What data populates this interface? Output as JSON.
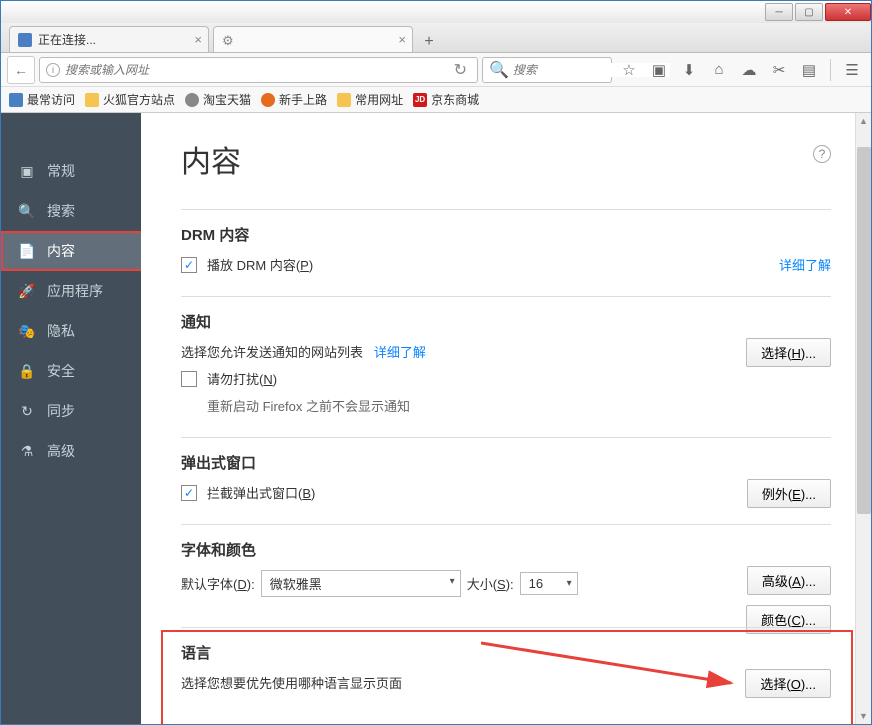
{
  "window": {
    "tabs": [
      {
        "title": "正在连接..."
      },
      {
        "title": ""
      }
    ]
  },
  "nav": {
    "url_placeholder": "搜索或输入网址",
    "search_placeholder": "搜索"
  },
  "bookmarks": [
    {
      "label": "最常访问"
    },
    {
      "label": "火狐官方站点"
    },
    {
      "label": "淘宝天猫"
    },
    {
      "label": "新手上路"
    },
    {
      "label": "常用网址"
    },
    {
      "label": "京东商城",
      "jd": "JD"
    }
  ],
  "sidebar": [
    {
      "label": "常规"
    },
    {
      "label": "搜索"
    },
    {
      "label": "内容"
    },
    {
      "label": "应用程序"
    },
    {
      "label": "隐私"
    },
    {
      "label": "安全"
    },
    {
      "label": "同步"
    },
    {
      "label": "高级"
    }
  ],
  "page": {
    "title": "内容",
    "drm": {
      "heading": "DRM 内容",
      "checkbox": "播放 DRM 内容(",
      "key": "P",
      "suffix": ")",
      "learn": "详细了解"
    },
    "notif": {
      "heading": "通知",
      "desc": "选择您允许发送通知的网站列表",
      "learn": "详细了解",
      "choose": "选择(",
      "choose_key": "H",
      "choose_suffix": ")...",
      "dnd": "请勿打扰(",
      "dnd_key": "N",
      "dnd_suffix": ")",
      "note": "重新启动 Firefox 之前不会显示通知"
    },
    "popup": {
      "heading": "弹出式窗口",
      "checkbox": "拦截弹出式窗口(",
      "key": "B",
      "suffix": ")",
      "except": "例外(",
      "except_key": "E",
      "except_suffix": ")..."
    },
    "font": {
      "heading": "字体和颜色",
      "default_label": "默认字体(",
      "default_key": "D",
      "default_suffix": "):",
      "font_value": "微软雅黑",
      "size_label": "大小(",
      "size_key": "S",
      "size_suffix": "):",
      "size_value": "16",
      "adv": "高级(",
      "adv_key": "A",
      "adv_suffix": ")...",
      "color": "颜色(",
      "color_key": "C",
      "color_suffix": ")..."
    },
    "lang": {
      "heading": "语言",
      "desc": "选择您想要优先使用哪种语言显示页面",
      "choose": "选择(",
      "choose_key": "O",
      "choose_suffix": ")..."
    }
  }
}
